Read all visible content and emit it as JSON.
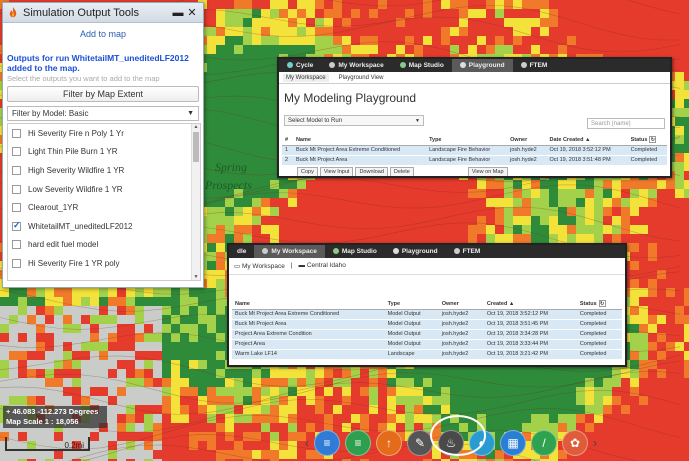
{
  "tools_panel": {
    "title": "Simulation Output Tools",
    "add_link": "Add to map",
    "message": "Outputs for run WhitetailMT_uneditedLF2012 added to the map.",
    "instruction": "Select the outputs you want to add to the map",
    "filter_button": "Filter by Map Extent",
    "model_filter": "Filter by Model: Basic",
    "outputs": [
      {
        "label": "Hi Severity Fire n Poly 1 Yr",
        "checked": false
      },
      {
        "label": "Light Thin Pile Burn 1 YR",
        "checked": false
      },
      {
        "label": "High Severity Wildfire 1 YR",
        "checked": false
      },
      {
        "label": "Low Severity Wildfire 1 YR",
        "checked": false
      },
      {
        "label": "Clearout_1YR",
        "checked": false
      },
      {
        "label": "WhitetailMT_uneditedLF2012",
        "checked": true
      },
      {
        "label": "hard edit fuel model",
        "checked": false
      },
      {
        "label": "Hi Severity Fire 1 YR poly",
        "checked": false
      }
    ]
  },
  "playground": {
    "tabs": [
      "Cycle",
      "My Workspace",
      "Map Studio",
      "Playground",
      "FTEM"
    ],
    "subnav": [
      "My Workspace",
      "Playground View"
    ],
    "title": "My Modeling Playground",
    "select_placeholder": "Select Model to Run",
    "search_placeholder": "Search (name)",
    "columns": [
      "#",
      "Name",
      "Type",
      "Owner",
      "Date Created ▲",
      "Status"
    ],
    "rows": [
      [
        "1",
        "Buck Mt Project Area Extreme Conditioned",
        "Landscape Fire Behavior",
        "josh.hyde2",
        "Oct 19, 2018 3:52:12 PM",
        "Completed"
      ],
      [
        "2",
        "Buck Mt Project Area",
        "Landscape Fire Behavior",
        "josh.hyde2",
        "Oct 19, 2018 3:51:48 PM",
        "Completed"
      ]
    ],
    "actions": [
      "Copy",
      "View Input",
      "Download",
      "Delete"
    ],
    "view_on_map": "View on Map"
  },
  "workspace": {
    "tabs": [
      "dle",
      "My Workspace",
      "Map Studio",
      "Playground",
      "FTEM"
    ],
    "crumb": [
      "My Workspace",
      "Central Idaho"
    ],
    "columns": [
      "Name",
      "Type",
      "Owner",
      "Created ▲",
      "Status"
    ],
    "rows": [
      [
        "Buck Mt Project Area Extreme Conditioned",
        "Model Output",
        "josh.hyde2",
        "Oct 19, 2018 3:52:12 PM",
        "Completed"
      ],
      [
        "Buck Mt Project Area",
        "Model Output",
        "josh.hyde2",
        "Oct 19, 2018 3:51:45 PM",
        "Completed"
      ],
      [
        "Project Area Extreme Condition",
        "Model Output",
        "josh.hyde2",
        "Oct 19, 2018 3:34:28 PM",
        "Completed"
      ],
      [
        "Project Area",
        "Model Output",
        "josh.hyde2",
        "Oct 19, 2018 3:33:44 PM",
        "Completed"
      ],
      [
        "Warm Lake LF14",
        "Landscape",
        "josh.hyde2",
        "Oct 19, 2018 3:21:42 PM",
        "Completed"
      ]
    ]
  },
  "map": {
    "coords": "46.083 -112.273 Degrees",
    "scale": "Map Scale 1 : 18,056",
    "scale_bar": "0.2mi",
    "labels": [
      "Spring",
      "Prospects"
    ]
  },
  "toolbar": {
    "prev": "‹",
    "next": "›",
    "buttons": [
      {
        "name": "layers-icon",
        "color": "#2f7bd6",
        "glyph": "≡"
      },
      {
        "name": "layers-green-icon",
        "color": "#2e9e4f",
        "glyph": "≡"
      },
      {
        "name": "upload-icon",
        "color": "#e46b1a",
        "glyph": "↑"
      },
      {
        "name": "tools-icon",
        "color": "#555555",
        "glyph": "✎"
      },
      {
        "name": "fire-icon",
        "color": "#4a4a4a",
        "glyph": "♨"
      },
      {
        "name": "globe-icon",
        "color": "#2a9bd0",
        "glyph": "◐"
      },
      {
        "name": "grid-icon",
        "color": "#2a7fd4",
        "glyph": "▦"
      },
      {
        "name": "ruler-icon",
        "color": "#2ea24e",
        "glyph": "/"
      },
      {
        "name": "palette-icon",
        "color": "#e05b3a",
        "glyph": "✿"
      }
    ]
  }
}
